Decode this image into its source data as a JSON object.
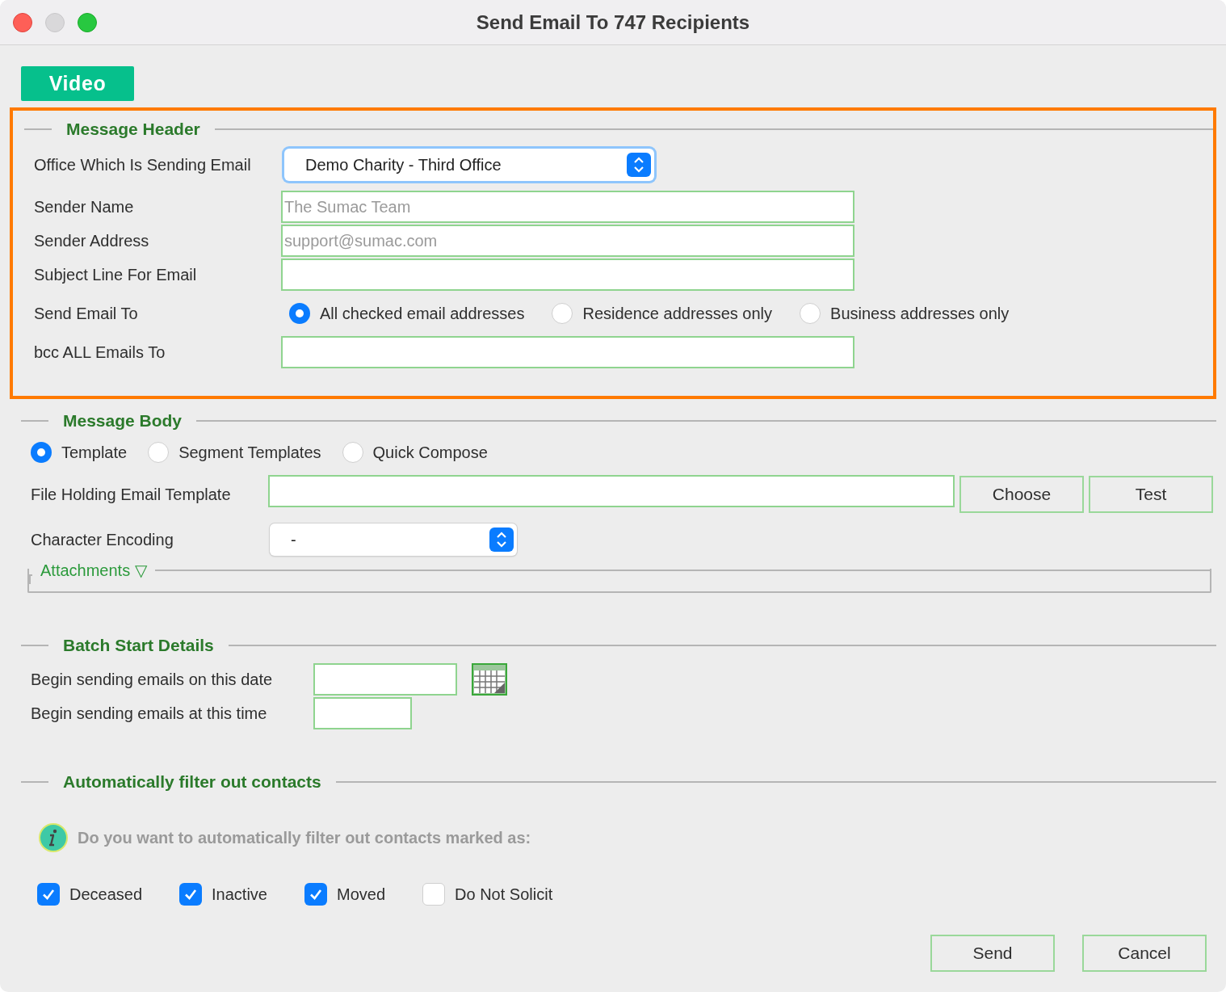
{
  "window": {
    "title": "Send Email To 747 Recipients"
  },
  "video_button": "Video",
  "message_header": {
    "title": "Message Header",
    "office": {
      "label": "Office Which Is Sending Email",
      "value": "Demo Charity - Third Office"
    },
    "sender_name": {
      "label": "Sender Name",
      "placeholder": "The Sumac Team"
    },
    "sender_address": {
      "label": "Sender Address",
      "placeholder": "support@sumac.com"
    },
    "subject": {
      "label": "Subject Line For Email"
    },
    "send_to": {
      "label": "Send Email To",
      "options": [
        {
          "label": "All checked email addresses",
          "selected": true
        },
        {
          "label": "Residence addresses only",
          "selected": false
        },
        {
          "label": "Business addresses only",
          "selected": false
        }
      ]
    },
    "bcc": {
      "label": "bcc ALL Emails To"
    }
  },
  "message_body": {
    "title": "Message Body",
    "modes": [
      {
        "label": "Template",
        "selected": true
      },
      {
        "label": "Segment Templates",
        "selected": false
      },
      {
        "label": "Quick Compose",
        "selected": false
      }
    ],
    "template_file": {
      "label": "File Holding Email Template"
    },
    "file_buttons": [
      "Choose",
      "Test"
    ],
    "encoding": {
      "label": "Character Encoding",
      "value": "-"
    },
    "attachments": {
      "label": "Attachments ▽"
    }
  },
  "batch_start": {
    "title": "Batch Start Details",
    "date": {
      "label": "Begin sending emails on this date"
    },
    "time": {
      "label": "Begin sending emails at this time"
    }
  },
  "filter": {
    "title": "Automatically filter out contacts",
    "info": "Do you want to automatically filter out contacts marked as:",
    "options": [
      {
        "label": "Deceased",
        "checked": true
      },
      {
        "label": "Inactive",
        "checked": true
      },
      {
        "label": "Moved",
        "checked": true
      },
      {
        "label": "Do Not Solicit",
        "checked": false
      }
    ]
  },
  "buttons": [
    "Send",
    "Cancel"
  ]
}
